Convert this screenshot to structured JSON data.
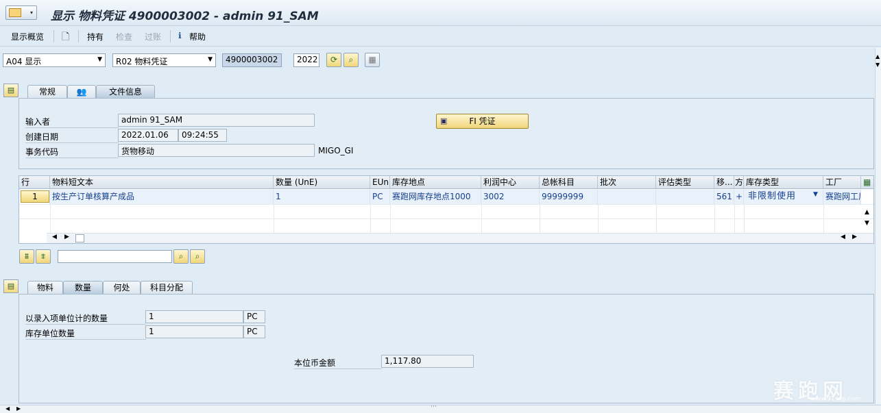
{
  "window": {
    "title": "显示 物料凭证 4900003002 - admin 91_SAM"
  },
  "toolbar": {
    "overview_label": "显示概览",
    "hold_label": "持有",
    "check_label": "检查",
    "post_label": "过账",
    "help_label": "帮助"
  },
  "selection": {
    "action_value": "A04 显示",
    "reference_value": "R02 物料凭证",
    "document_number": "4900003002",
    "year": "2022"
  },
  "header_tabs": [
    {
      "label": "常规"
    },
    {
      "label": ""
    },
    {
      "label": "文件信息"
    }
  ],
  "header": {
    "entered_by_label": "输入者",
    "entered_by_value": "admin 91_SAM",
    "created_date_label": "创建日期",
    "created_date_value": "2022.01.06",
    "created_time_value": "09:24:55",
    "trans_code_label": "事务代码",
    "trans_code_value": "货物移动",
    "trans_code_extra": "MIGO_GI",
    "fi_button_label": "FI 凭证"
  },
  "items_table": {
    "columns": [
      "行",
      "物料短文本",
      "数量 (UnE)",
      "EUn",
      "库存地点",
      "利润中心",
      "总帐科目",
      "批次",
      "评估类型",
      "移...",
      "方",
      "库存类型",
      "工厂"
    ],
    "rows": [
      {
        "line_no": "1",
        "material_text": "按生产订单核算产成品",
        "quantity": "1",
        "unit": "PC",
        "storage_location": "赛跑网库存地点1000",
        "profit_center": "3002",
        "gl_account": "99999999",
        "batch": "",
        "valuation_type": "",
        "movement_type": "561",
        "direction": "+",
        "stock_type": "非限制使用",
        "plant": "赛跑网工厂"
      }
    ]
  },
  "detail_tabs": [
    {
      "label": "物料"
    },
    {
      "label": "数量"
    },
    {
      "label": "何处"
    },
    {
      "label": "科目分配"
    }
  ],
  "detail": {
    "qty_entry_label": "以录入项单位计的数量",
    "qty_entry_value": "1",
    "qty_entry_unit": "PC",
    "qty_base_label": "库存单位数量",
    "qty_base_value": "1",
    "qty_base_unit": "PC",
    "amount_label": "本位币金额",
    "amount_value": "1,117.80"
  },
  "watermark": {
    "text": "赛跑网",
    "url": "www.91sap.com"
  },
  "colors": {
    "background": "#dfebf5",
    "button_gold": "#f0d57b",
    "link_blue": "#163f8f"
  }
}
